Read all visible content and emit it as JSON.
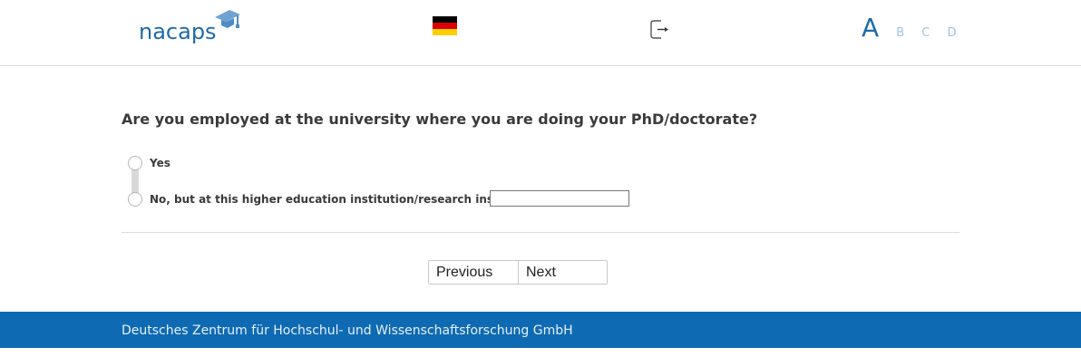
{
  "header": {
    "logo_text": "nacaps",
    "language_flag": "german-flag",
    "logout_icon": "logout-icon",
    "font_sizes": [
      "A",
      "B",
      "C",
      "D"
    ],
    "colors": {
      "brand": "#1f6aa8",
      "inactive": "#9ec4e3"
    }
  },
  "question": {
    "text": "Are you employed at the university where you are doing your PhD/doctorate?",
    "options": [
      {
        "label": "Yes",
        "selected": false
      },
      {
        "label": "No, but at this higher education institution/research institution:",
        "selected": false
      }
    ],
    "other_input": {
      "value": "",
      "placeholder": ""
    }
  },
  "navigation": {
    "previous_label": "Previous",
    "next_label": "Next"
  },
  "footer": {
    "text": "Deutsches Zentrum für Hochschul- und Wissenschaftsforschung GmbH",
    "color": "#0e6ab2"
  }
}
